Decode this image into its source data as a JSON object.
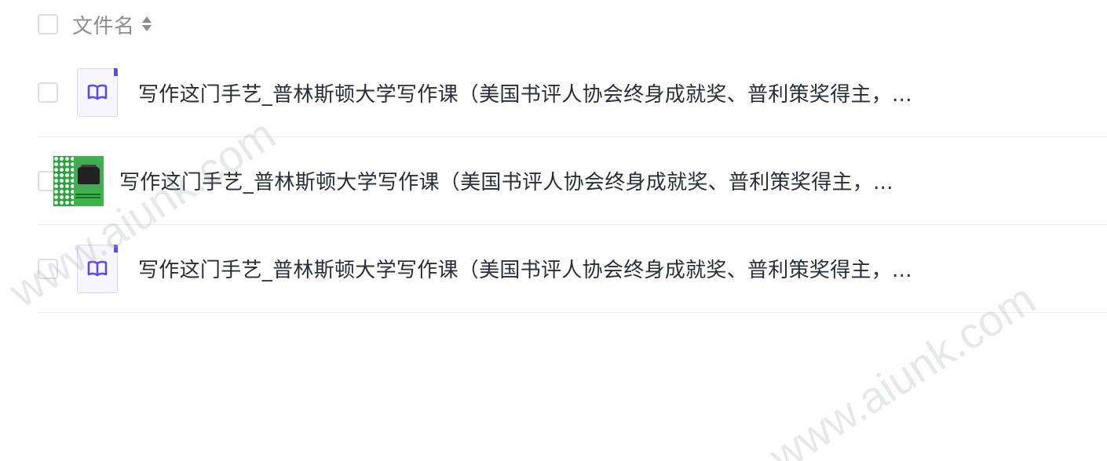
{
  "header": {
    "column_label": "文件名",
    "sort_icon": "sort-icon"
  },
  "files": [
    {
      "name": "写作这门手艺_普林斯顿大学写作课（美国书评人协会终身成就奖、普利策奖得主，...",
      "thumbnail": "book-icon"
    },
    {
      "name": "写作这门手艺_普林斯顿大学写作课（美国书评人协会终身成就奖、普利策奖得主，...",
      "thumbnail": "book-cover-image"
    },
    {
      "name": "写作这门手艺_普林斯顿大学写作课（美国书评人协会终身成就奖、普利策奖得主，...",
      "thumbnail": "book-icon"
    }
  ],
  "watermark": {
    "text": "www.aiunk.com"
  },
  "colors": {
    "accent": "#5b4ee6",
    "text": "#2b2d36",
    "muted": "#8b8d96",
    "border": "#dcdde3"
  }
}
